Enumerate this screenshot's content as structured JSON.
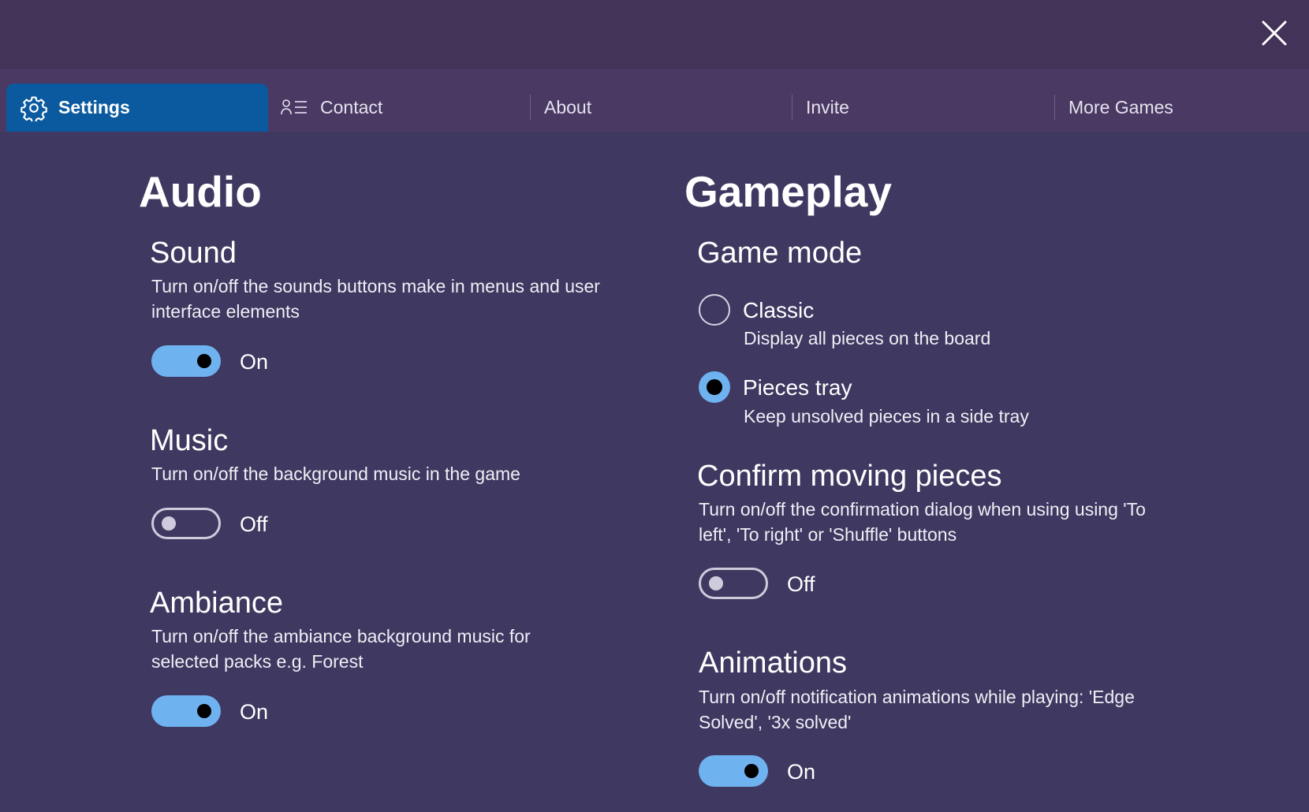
{
  "window": {
    "close_label": "close"
  },
  "tabs": [
    {
      "label": "Settings",
      "icon": "gear-icon",
      "active": true
    },
    {
      "label": "Contact",
      "icon": "contact-list-icon"
    },
    {
      "label": "About"
    },
    {
      "label": "Invite"
    },
    {
      "label": "More Games"
    }
  ],
  "audio": {
    "heading": "Audio",
    "sound": {
      "title": "Sound",
      "description": "Turn on/off the sounds buttons make in menus and user interface elements",
      "state": "On"
    },
    "music": {
      "title": "Music",
      "description": "Turn on/off the background music in the game",
      "state": "Off"
    },
    "ambiance": {
      "title": "Ambiance",
      "description": "Turn on/off the ambiance background music for selected packs e.g. Forest",
      "state": "On"
    }
  },
  "gameplay": {
    "heading": "Gameplay",
    "game_mode": {
      "title": "Game mode",
      "options": [
        {
          "label": "Classic",
          "description": "Display all pieces on the board",
          "selected": false
        },
        {
          "label": "Pieces tray",
          "description": "Keep unsolved pieces in a side tray",
          "selected": true
        }
      ]
    },
    "confirm_moving": {
      "title": "Confirm moving pieces",
      "description": "Turn on/off the confirmation dialog when using using 'To left', 'To right' or 'Shuffle' buttons",
      "state": "Off"
    },
    "animations": {
      "title": "Animations",
      "description": "Turn on/off notification animations while playing: 'Edge Solved', '3x solved'",
      "state": "On"
    }
  },
  "colors": {
    "background": "#3f3860",
    "tabbar": "#4a3a63",
    "active_tab": "#0b5aa0",
    "toggle_on": "#6fb2f0"
  }
}
